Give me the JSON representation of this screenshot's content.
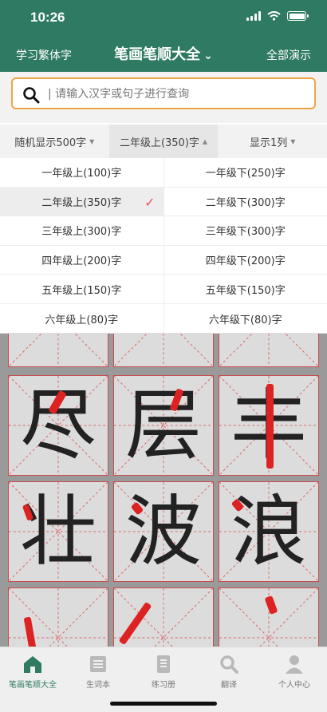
{
  "status": {
    "time": "10:26"
  },
  "nav": {
    "left": "学习繁体字",
    "title": "笔画笔顺大全",
    "right": "全部演示"
  },
  "search": {
    "placeholder": "| 请输入汉字或句子进行查询"
  },
  "filters": [
    "随机显示500字",
    "二年级上(350)字",
    "显示1列"
  ],
  "grades": {
    "left": [
      "一年级上(100)字",
      "二年级上(350)字",
      "三年级上(300)字",
      "四年级上(200)字",
      "五年级上(150)字",
      "六年级上(80)字"
    ],
    "right": [
      "一年级下(250)字",
      "二年级下(300)字",
      "三年级下(300)字",
      "四年级下(200)字",
      "五年级下(150)字",
      "六年级下(80)字"
    ],
    "selected": "二年级上(350)字"
  },
  "characters": [
    "尽",
    "层",
    "丰",
    "壮",
    "波",
    "浪"
  ],
  "tabs": [
    "笔画笔顺大全",
    "生词本",
    "练习册",
    "翻译",
    "个人中心"
  ],
  "colors": {
    "brand": "#2f7a62",
    "search_border": "#f0a44a",
    "check": "#e8555b",
    "stroke_highlight": "#d22222"
  }
}
